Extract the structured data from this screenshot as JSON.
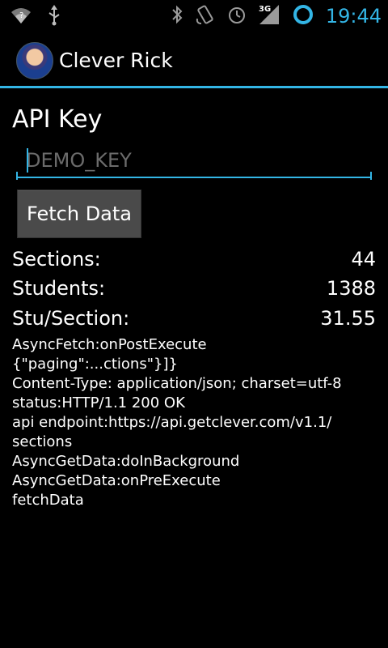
{
  "status_bar": {
    "time": "19:44",
    "network": "3G",
    "icons_left": [
      "wifi-icon",
      "usb-icon"
    ],
    "icons_right": [
      "bluetooth-icon",
      "rotate-icon",
      "alarm-icon",
      "signal-icon",
      "ring-icon"
    ],
    "accent": "#33b5e5"
  },
  "app_bar": {
    "title": "Clever Rick"
  },
  "form": {
    "api_key_label": "API Key",
    "api_key_placeholder": "DEMO_KEY",
    "fetch_button": "Fetch Data"
  },
  "stats": [
    {
      "label": "Sections:",
      "value": "44"
    },
    {
      "label": "Students:",
      "value": "1388"
    },
    {
      "label": "Stu/Section:",
      "value": "31.55"
    }
  ],
  "log_lines": [
    "AsyncFetch:onPostExecute",
    "{\"paging\":...ctions\"}]}",
    "Content-Type: application/json; charset=utf-8",
    "status:HTTP/1.1 200 OK",
    "api endpoint:https://api.getclever.com/v1.1/",
    "sections",
    "AsyncGetData:doInBackground",
    "AsyncGetData:onPreExecute",
    "fetchData"
  ]
}
